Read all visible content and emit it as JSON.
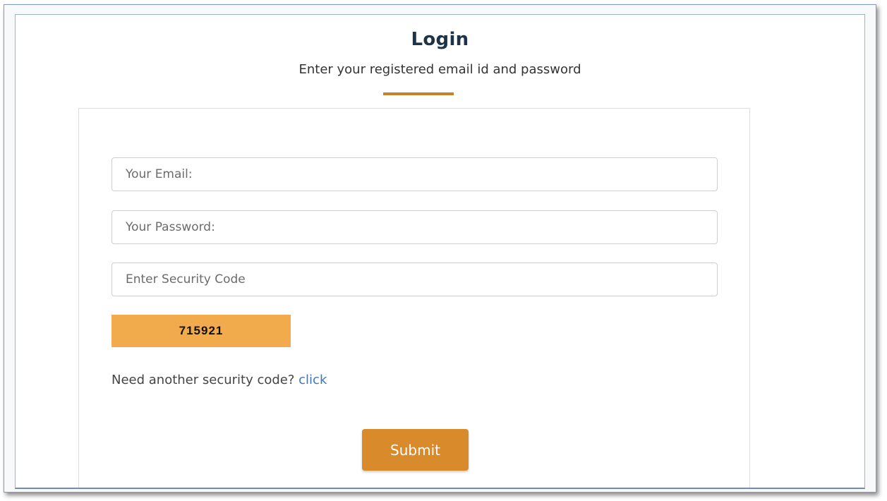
{
  "header": {
    "title": "Login",
    "subtitle": "Enter your registered email id and password"
  },
  "form": {
    "email": {
      "placeholder": "Your Email:",
      "value": ""
    },
    "password": {
      "placeholder": "Your Password:",
      "value": ""
    },
    "security_code": {
      "placeholder": "Enter Security Code",
      "value": ""
    },
    "captcha": {
      "code": "715921"
    },
    "refresh": {
      "text": "Need another security code?",
      "link_label": "click"
    },
    "submit_label": "Submit"
  },
  "colors": {
    "title": "#1c3348",
    "accent_underline": "#c6812c",
    "captcha_background": "#f2ab4c",
    "submit_background": "#d98a2b",
    "link": "#3b78c2"
  }
}
